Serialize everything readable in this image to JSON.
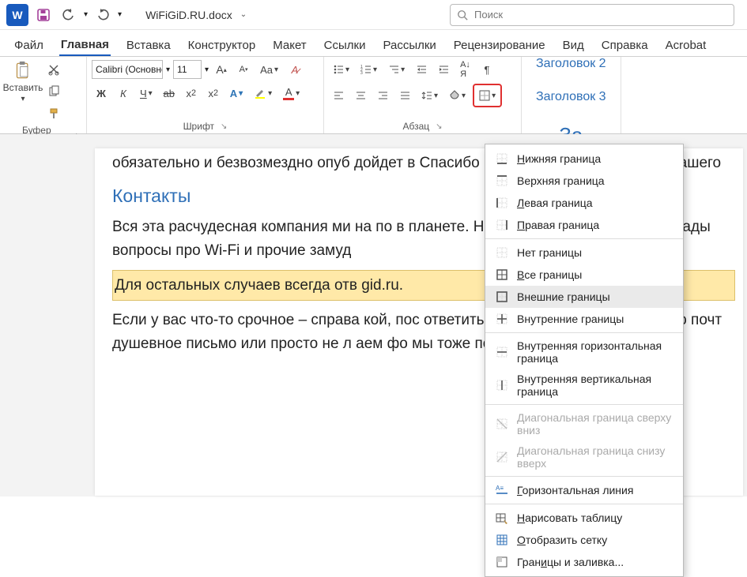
{
  "titlebar": {
    "app_glyph": "W",
    "filename": "WiFiGiD.RU.docx"
  },
  "search": {
    "placeholder": "Поиск"
  },
  "tabs": [
    "Файл",
    "Главная",
    "Вставка",
    "Конструктор",
    "Макет",
    "Ссылки",
    "Рассылки",
    "Рецензирование",
    "Вид",
    "Справка",
    "Acrobat"
  ],
  "active_tab_index": 1,
  "ribbon": {
    "clipboard": {
      "label": "Буфер обмена",
      "paste": "Вставить"
    },
    "font": {
      "label": "Шрифт",
      "name": "Calibri (Основной",
      "size": "11"
    },
    "paragraph": {
      "label": "Абзац"
    },
    "styles": {
      "items": [
        "Заголовок 2",
        "Заголовок 3",
        "За"
      ]
    }
  },
  "document": {
    "p1": "обязательно и безвозмездно опуб                                           дойдет в Спасибо и разместим Ваше фото в                                                   нашего",
    "h1": "Контакты",
    "p2": "Вся эта расчудесная компания ми                                              на по в планете. Но если вы вдруг окажет                                                       ем рады вопросы про Wi-Fi и прочие замуд",
    "hl": "Для остальных случаев всегда отв                                              gid.ru.",
    "p3": "Если у вас что-то срочное – справа                                                     кой, пос ответить на ваш вопрос. Тем же, к                                                    ою почт душевное письмо или просто не л                                                 аем фо мы тоже получим ваше сообщени"
  },
  "borders_menu": {
    "items": [
      {
        "label": "Нижняя граница",
        "icon": "border-bottom",
        "underline": "Н"
      },
      {
        "label": "Верхняя граница",
        "icon": "border-top"
      },
      {
        "label": "Левая граница",
        "icon": "border-left",
        "underline": "Л"
      },
      {
        "label": "Правая граница",
        "icon": "border-right",
        "underline": "П"
      },
      {
        "sep": true
      },
      {
        "label": "Нет границы",
        "icon": "border-none"
      },
      {
        "label": "Все границы",
        "icon": "border-all",
        "underline": "В"
      },
      {
        "label": "Внешние границы",
        "icon": "border-outside",
        "hover": true
      },
      {
        "label": "Внутренние границы",
        "icon": "border-inside"
      },
      {
        "sep": true
      },
      {
        "label": "Внутренняя горизонтальная граница",
        "icon": "border-ih"
      },
      {
        "label": "Внутренняя вертикальная граница",
        "icon": "border-iv"
      },
      {
        "sep": true
      },
      {
        "label": "Диагональная граница сверху вниз",
        "icon": "border-diag1",
        "disabled": true
      },
      {
        "label": "Диагональная граница снизу вверх",
        "icon": "border-diag2",
        "disabled": true
      },
      {
        "sep": true
      },
      {
        "label": "Горизонтальная линия",
        "icon": "hline",
        "underline": "Г"
      },
      {
        "sep": true
      },
      {
        "label": "Нарисовать таблицу",
        "icon": "draw-table",
        "underline": "Н"
      },
      {
        "label": "Отобразить сетку",
        "icon": "grid",
        "underline": "О"
      },
      {
        "label": "Границы и заливка...",
        "icon": "borders-shading",
        "underline": "и"
      }
    ]
  }
}
